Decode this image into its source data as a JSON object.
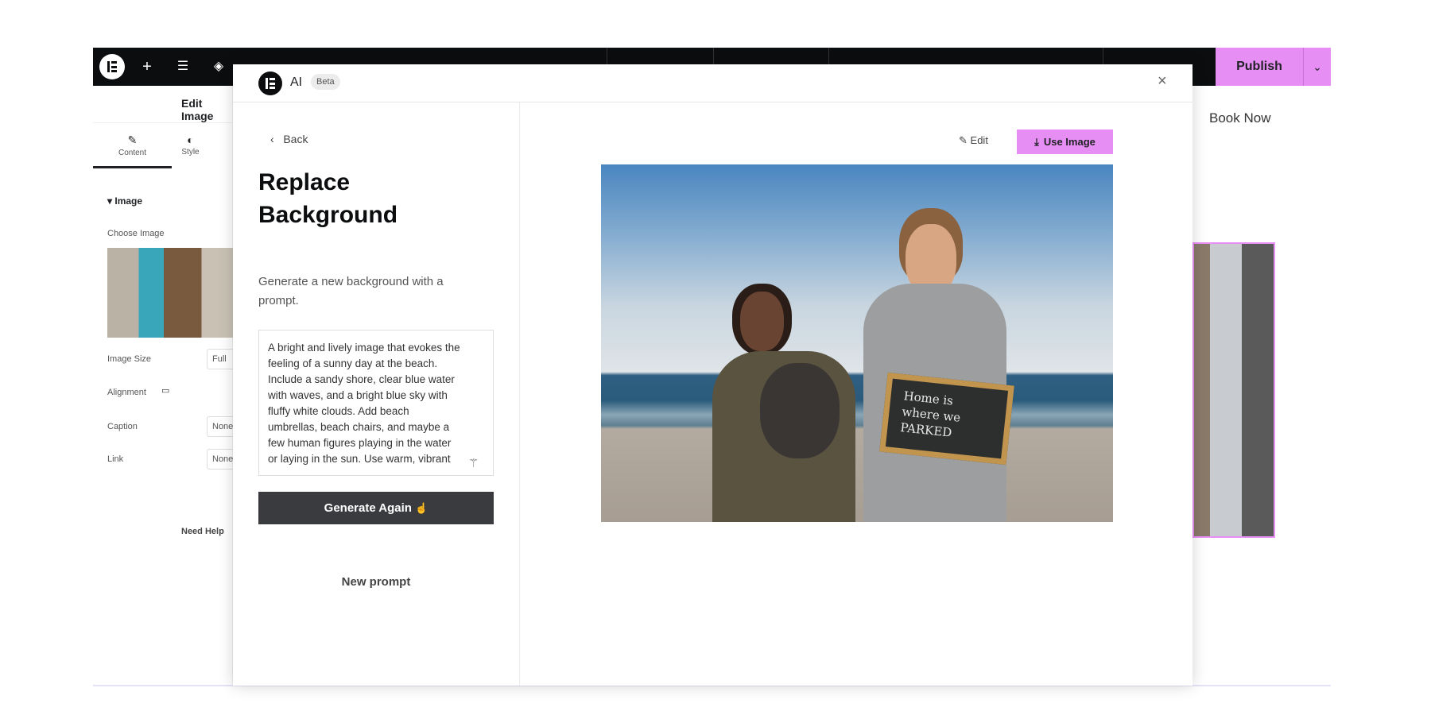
{
  "topbar": {
    "publish_label": "Publish",
    "icons": [
      "elementor-logo-icon",
      "plus-icon",
      "sliders-icon",
      "layers-icon",
      "page-icon",
      "desktop-icon",
      "tablet-icon",
      "mobile-icon",
      "search-icon",
      "help-icon",
      "eye-icon",
      "chevron-down-icon"
    ]
  },
  "editor": {
    "title": "Edit Image",
    "tabs": [
      {
        "label": "Content"
      },
      {
        "label": "Style"
      }
    ],
    "section": "Image",
    "choose_image": "Choose Image",
    "fields": [
      {
        "label": "Image Size",
        "value": "Full"
      },
      {
        "label": "Alignment"
      },
      {
        "label": "Caption",
        "value": "None"
      },
      {
        "label": "Link",
        "value": "None"
      }
    ],
    "need_help": "Need Help"
  },
  "preview": {
    "book_now": "Book Now"
  },
  "modal": {
    "title": "AI",
    "badge": "Beta",
    "back": "Back",
    "heading_line1": "Replace",
    "heading_line2": "Background",
    "subtitle": "Generate a new background with a prompt.",
    "prompt": "A bright and lively image that evokes the feeling of a sunny day at the beach. Include a sandy shore, clear blue water with waves, and a bright blue sky with fluffy white clouds. Add beach umbrellas, beach chairs, and maybe a few human figures playing in the water or laying in the sun. Use warm, vibrant",
    "generate_again": "Generate Again",
    "new_prompt": "New prompt",
    "edit": "Edit",
    "use_image": "Use Image",
    "sign_text": "Home is where we PARKED"
  },
  "colors": {
    "accent": "#e78ef5",
    "topbar": "#0c0d0e",
    "button_dark": "#3a3b3f"
  }
}
